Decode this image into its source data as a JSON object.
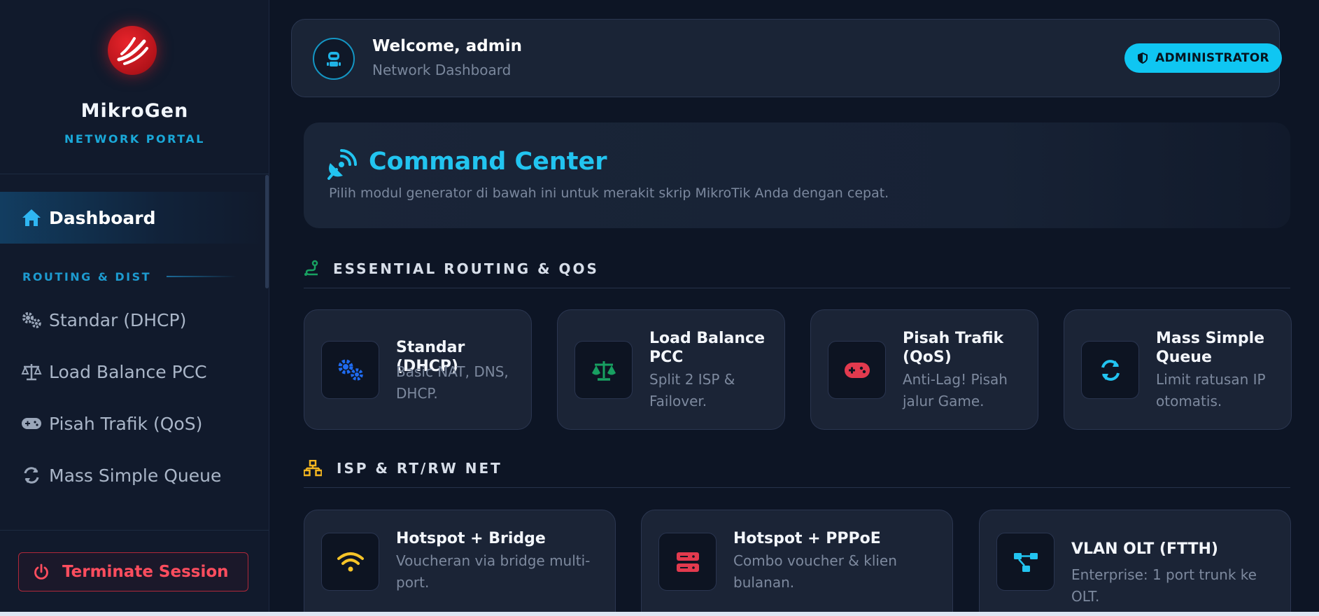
{
  "brand": {
    "name": "MikroGen",
    "subtitle": "NETWORK PORTAL"
  },
  "sidebar": {
    "active_item": {
      "label": "Dashboard",
      "icon": "home-icon"
    },
    "section_label": "ROUTING & DIST",
    "items": [
      {
        "label": "Standar (DHCP)",
        "icon": "gears-icon"
      },
      {
        "label": "Load Balance PCC",
        "icon": "scale-icon"
      },
      {
        "label": "Pisah Trafik (QoS)",
        "icon": "gamepad-icon"
      },
      {
        "label": "Mass Simple Queue",
        "icon": "sync-icon"
      }
    ],
    "terminate_label": "Terminate Session"
  },
  "header": {
    "welcome": "Welcome, admin",
    "subtitle": "Network Dashboard",
    "role_badge": "ADMINISTRATOR"
  },
  "hero": {
    "title": "Command Center",
    "description": "Pilih modul generator di bawah ini untuk merakit skrip MikroTik Anda dengan cepat."
  },
  "sections": [
    {
      "label": "ESSENTIAL ROUTING & QOS",
      "icon": "route-icon",
      "cards": [
        {
          "title": "Standar (DHCP)",
          "desc": "Basic NAT, DNS, DHCP.",
          "icon": "gears-icon"
        },
        {
          "title": "Load Balance PCC",
          "desc": "Split 2 ISP & Failover.",
          "icon": "scale-icon"
        },
        {
          "title": "Pisah Trafik (QoS)",
          "desc": "Anti-Lag! Pisah jalur Game.",
          "icon": "gamepad-icon"
        },
        {
          "title": "Mass Simple Queue",
          "desc": "Limit ratusan IP otomatis.",
          "icon": "sync-icon"
        }
      ]
    },
    {
      "label": "ISP & RT/RW NET",
      "icon": "network-icon",
      "cards": [
        {
          "title": "Hotspot + Bridge",
          "desc": "Voucheran via bridge multi-port.",
          "icon": "wifi-icon"
        },
        {
          "title": "Hotspot + PPPoE",
          "desc": "Combo voucher & klien bulanan.",
          "icon": "server-icon"
        },
        {
          "title": "VLAN OLT (FTTH)",
          "desc": "Enterprise: 1 port trunk ke OLT.",
          "icon": "diagram-icon"
        }
      ]
    }
  ],
  "colors": {
    "accent": "#0fc6f2",
    "background": "#0d1525",
    "sidebar": "#111a2c",
    "card": "#1b2436",
    "danger": "#ff4d5e",
    "gear_blue": "#1f6bf0",
    "scale_green": "#18a061",
    "gamepad_red": "#e23a4e",
    "wifi_yellow": "#f6c428",
    "network_yellow": "#f2b520"
  }
}
